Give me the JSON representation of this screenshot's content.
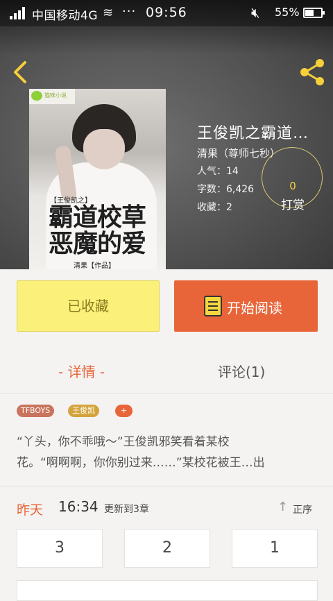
{
  "status_bar": {
    "carrier": "中国移动4G",
    "dots": "···",
    "time": "09:56",
    "battery": "55%",
    "battery_level": 0.55
  },
  "book": {
    "title": "王俊凯之霸道…",
    "author": "清果（尊师七秒）",
    "popularity": "人气：14",
    "word_count": "字数：6,426",
    "favorites": "收藏：2",
    "tip_count": "0",
    "tip_label": "打赏"
  },
  "cover": {
    "badge": "猫咪小说",
    "subtitle": "【王俊凯之】",
    "title_line1": "霸道校草",
    "title_line2": "恶魔的爱",
    "author": "清果【作品】"
  },
  "actions": {
    "favorite_label": "已收藏",
    "read_label": "开始阅读"
  },
  "tabs": {
    "detail": "- 详情 -",
    "comments": "评论(1)"
  },
  "tags": [
    {
      "label": "TFBOYS",
      "color": "#c9745c"
    },
    {
      "label": "王俊凯",
      "color": "#d4a43c"
    },
    {
      "label": "+",
      "color": "#e8653a"
    }
  ],
  "summary": {
    "line1": "“丫头，你不乖哦～”王俊凯邪笑看着某校",
    "line2": "花。“啊啊啊，你你别过来……”某校花被王…出"
  },
  "update": {
    "day": "昨天",
    "time": "16:34",
    "text": "更新到3章",
    "sort_label": "正序"
  },
  "chapters": [
    "3",
    "2",
    "1"
  ],
  "colors": {
    "accent": "#e8653a",
    "favorite_bg": "#faf07a"
  }
}
